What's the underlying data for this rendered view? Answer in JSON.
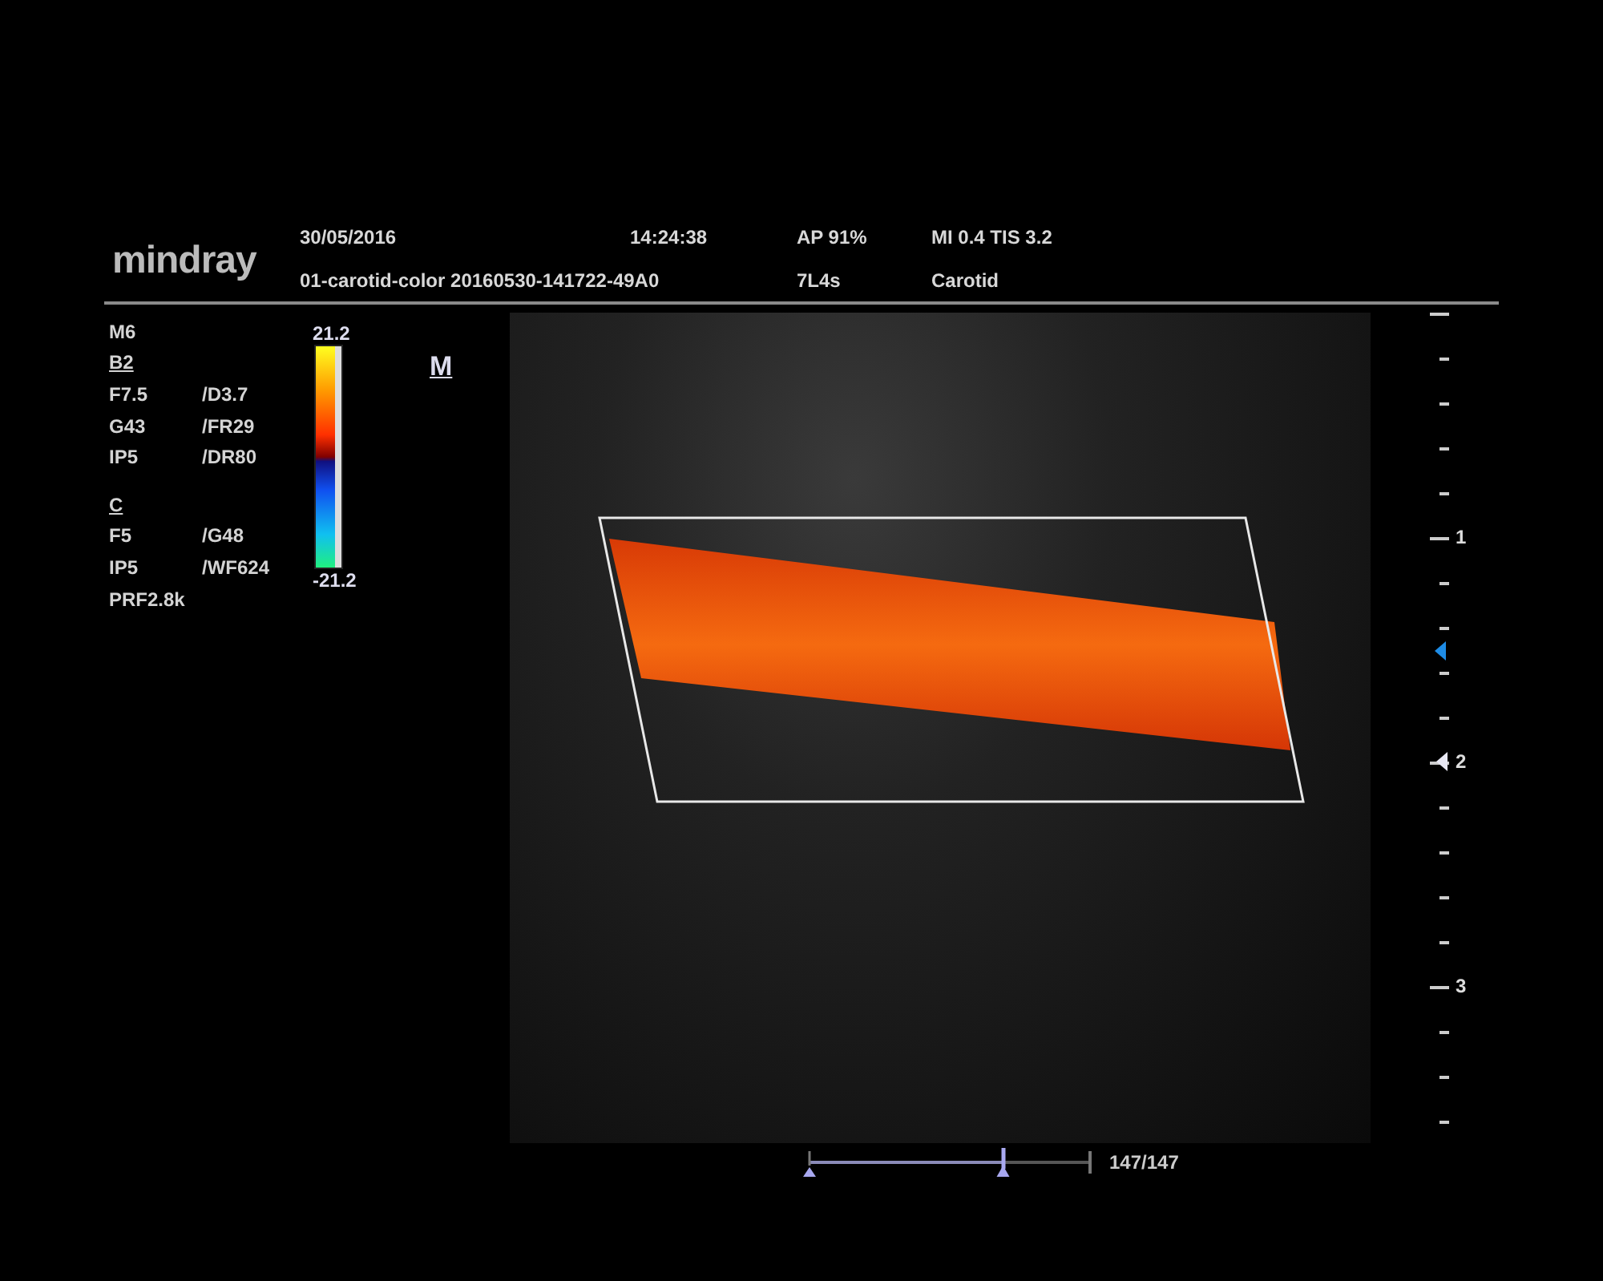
{
  "header": {
    "logo": "mindray",
    "date": "30/05/2016",
    "time": "14:24:38",
    "acoustic_power": "AP 91%",
    "indices": "MI 0.4 TIS 3.2",
    "file_name": "01-carotid-color 20160530-141722-49A0",
    "probe": "7L4s",
    "preset": "Carotid"
  },
  "parameters": [
    {
      "kind": "text",
      "text": "M6"
    },
    {
      "kind": "section",
      "text": "B2"
    },
    {
      "kind": "pair",
      "left": "F7.5",
      "right": "/D3.7"
    },
    {
      "kind": "pair",
      "left": "G43",
      "right": "/FR29"
    },
    {
      "kind": "pair",
      "left": "IP5",
      "right": "/DR80"
    },
    {
      "kind": "spacer"
    },
    {
      "kind": "section",
      "text": "C"
    },
    {
      "kind": "pair",
      "left": "F5",
      "right": "/G48"
    },
    {
      "kind": "pair",
      "left": "IP5",
      "right": "/WF624"
    },
    {
      "kind": "text",
      "text": "PRF2.8k"
    }
  ],
  "color_scale": {
    "max": "21.2",
    "min": "-21.2"
  },
  "orientation_mark": "M",
  "depth_scale": {
    "labels": [
      "1",
      "2",
      "3"
    ]
  },
  "cine": {
    "level": 0.69,
    "frames": "147/147"
  }
}
